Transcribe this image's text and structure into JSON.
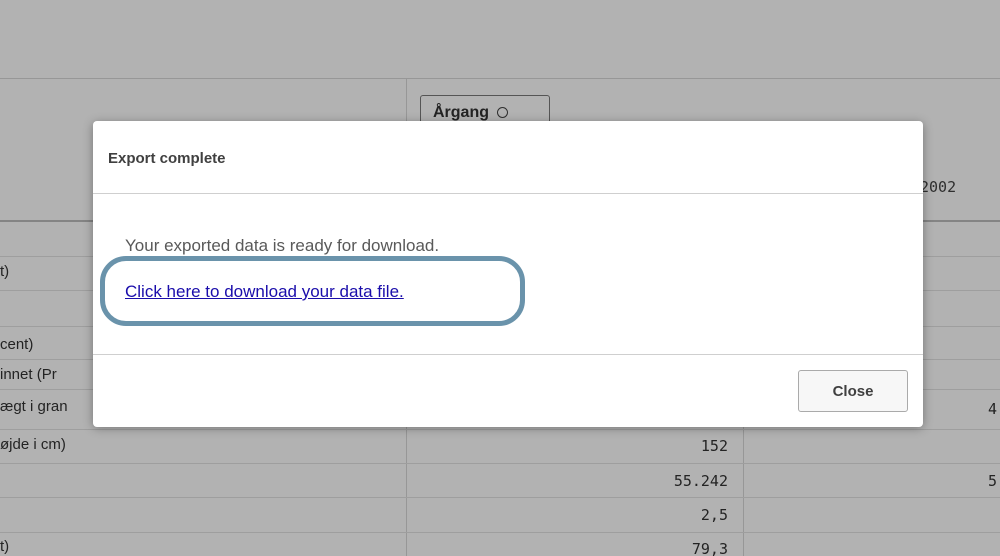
{
  "background": {
    "filter": {
      "label": "Årgang"
    },
    "column_header_value": "2002",
    "rows": [
      {
        "label": "t)",
        "value": "",
        "edge": ""
      },
      {
        "label": "",
        "value": "",
        "edge": ""
      },
      {
        "label": "cent)",
        "value": "",
        "edge": ""
      },
      {
        "label": "innet (Pr",
        "value": "",
        "edge": ""
      },
      {
        "label": "ægt i gran",
        "value": "",
        "edge": "4"
      },
      {
        "label": "øjde i cm)",
        "value": "152",
        "edge": ""
      },
      {
        "label": "",
        "value": "55.242",
        "edge": "5"
      },
      {
        "label": "",
        "value": "2,5",
        "edge": ""
      },
      {
        "label": "t)",
        "value": "79,3",
        "edge": ""
      }
    ]
  },
  "dialog": {
    "title": "Export complete",
    "message": "Your exported data is ready for download.",
    "link_label": "Click here to download your data file.",
    "close_label": "Close",
    "highlight_color": "#6a93ab",
    "link_color": "#1a0dab"
  }
}
